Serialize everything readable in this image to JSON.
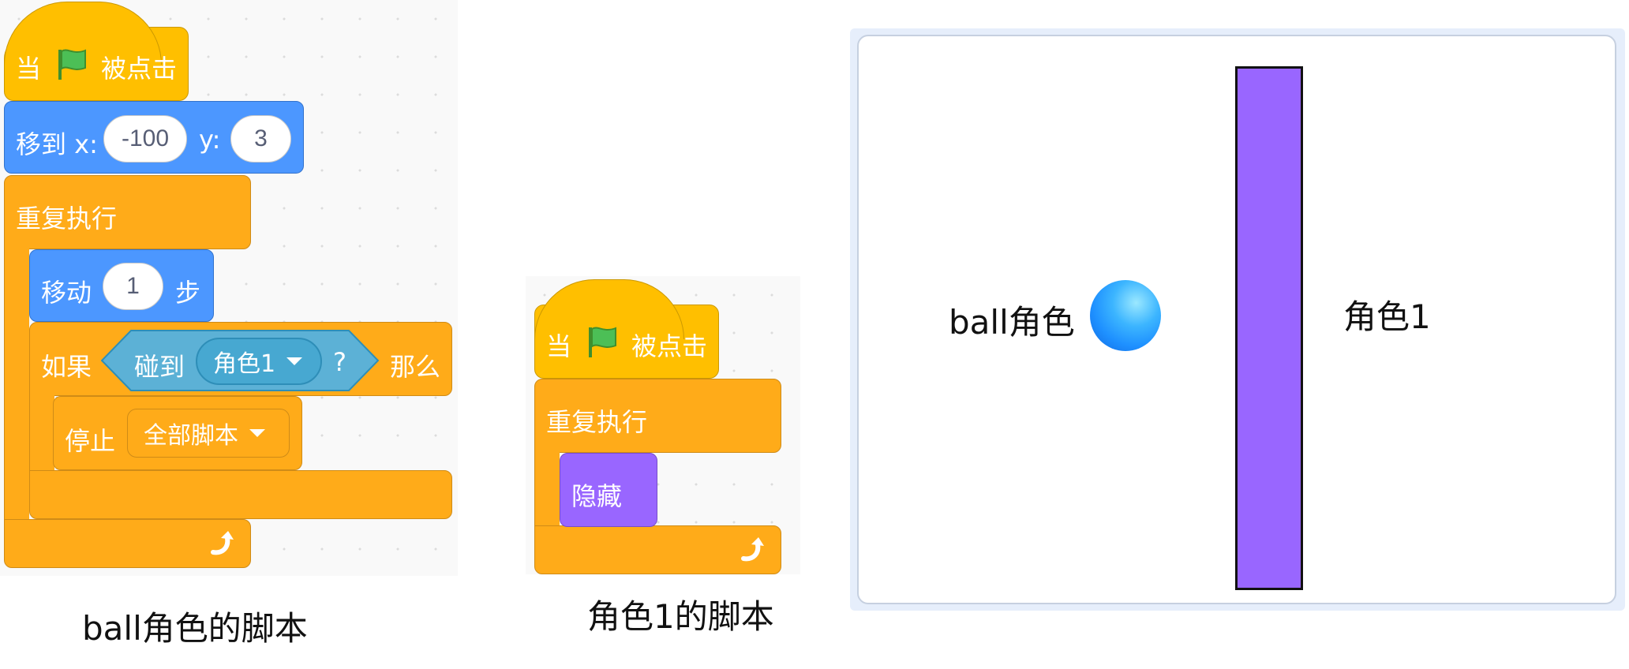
{
  "ball_script": {
    "hat": {
      "when": "当",
      "clicked": "被点击",
      "flag_icon": "green-flag-icon"
    },
    "goto": {
      "label": "移到 x:",
      "x_value": "-100",
      "y_label": "y:",
      "y_value": "3"
    },
    "forever": {
      "label": "重复执行"
    },
    "move": {
      "label": "移动",
      "steps": "1",
      "unit": "步"
    },
    "if": {
      "label": "如果",
      "then": "那么"
    },
    "touching": {
      "label": "碰到",
      "target": "角色1",
      "question": "?"
    },
    "stop": {
      "label": "停止",
      "option": "全部脚本"
    },
    "loop_arrow_icon": "loop-arrow-icon",
    "caption": "ball角色的脚本"
  },
  "sprite1_script": {
    "hat": {
      "when": "当",
      "clicked": "被点击",
      "flag_icon": "green-flag-icon"
    },
    "forever": {
      "label": "重复执行"
    },
    "hide": {
      "label": "隐藏"
    },
    "loop_arrow_icon": "loop-arrow-icon",
    "caption": "角色1的脚本"
  },
  "stage": {
    "ball_label": "ball角色",
    "wall_label": "角色1",
    "colors": {
      "ball": "#1e90ff",
      "wall": "#9966ff",
      "wall_border": "#111111"
    }
  },
  "colors": {
    "events": "#ffbf00",
    "control": "#ffab19",
    "motion": "#4c97ff",
    "looks": "#9966ff",
    "sensing": "#5cb1d6"
  }
}
